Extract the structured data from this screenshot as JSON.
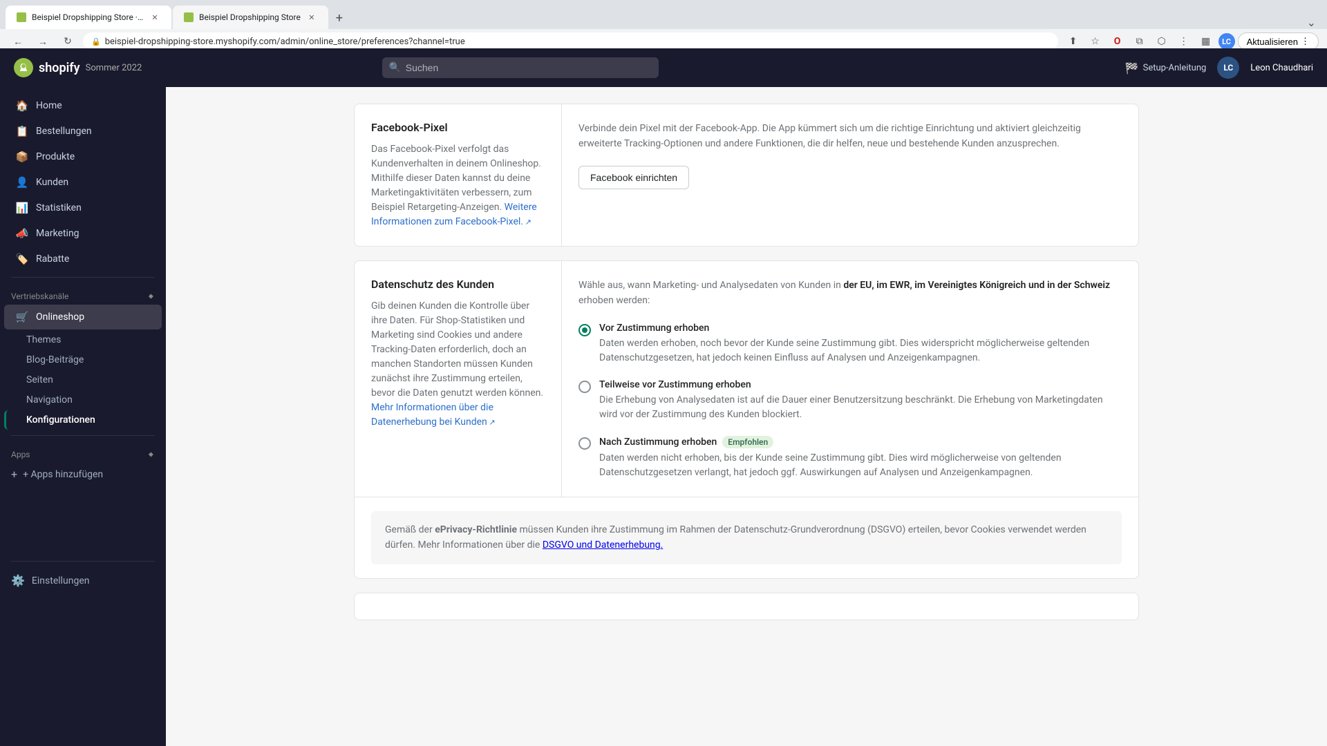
{
  "browser": {
    "tabs": [
      {
        "id": "tab1",
        "title": "Beispiel Dropshipping Store ·...",
        "active": true,
        "favicon_color": "#96bf48"
      },
      {
        "id": "tab2",
        "title": "Beispiel Dropshipping Store",
        "active": false,
        "favicon_color": "#96bf48"
      }
    ],
    "address": "beispiel-dropshipping-store.myshopify.com/admin/online_store/preferences?channel=true",
    "update_btn": "Aktualisieren"
  },
  "header": {
    "logo_text": "shopify",
    "season": "Sommer 2022",
    "search_placeholder": "Suchen",
    "setup_link": "Setup-Anleitung",
    "user_initials": "LC",
    "user_name": "Leon Chaudhari"
  },
  "sidebar": {
    "nav_items": [
      {
        "id": "home",
        "label": "Home",
        "icon": "🏠"
      },
      {
        "id": "bestellungen",
        "label": "Bestellungen",
        "icon": "📋"
      },
      {
        "id": "produkte",
        "label": "Produkte",
        "icon": "📦"
      },
      {
        "id": "kunden",
        "label": "Kunden",
        "icon": "👤"
      },
      {
        "id": "statistiken",
        "label": "Statistiken",
        "icon": "📊"
      },
      {
        "id": "marketing",
        "label": "Marketing",
        "icon": "📣"
      },
      {
        "id": "rabatte",
        "label": "Rabatte",
        "icon": "🏷️"
      }
    ],
    "vertriebskanaele_label": "Vertriebskanäle",
    "online_shop_label": "Onlineshop",
    "sub_items": [
      {
        "id": "themes",
        "label": "Themes"
      },
      {
        "id": "blog-beitraege",
        "label": "Blog-Beiträge"
      },
      {
        "id": "seiten",
        "label": "Seiten"
      },
      {
        "id": "navigation",
        "label": "Navigation"
      },
      {
        "id": "konfigurationen",
        "label": "Konfigurationen",
        "current": true
      }
    ],
    "apps_label": "Apps",
    "add_apps_label": "+ Apps hinzufügen",
    "settings_label": "Einstellungen"
  },
  "facebook_section": {
    "title": "Facebook-Pixel",
    "description": "Das Facebook-Pixel verfolgt das Kundenverhalten in deinem Onlineshop. Mithilfe dieser Daten kannst du deine Marketingaktivitäten verbessern, zum Beispiel Retargeting-Anzeigen.",
    "link_text": "Weitere Informationen zum Facebook-Pixel.",
    "right_text": "Verbinde dein Pixel mit der Facebook-App. Die App kümmert sich um die richtige Einrichtung und aktiviert gleichzeitig erweiterte Tracking-Optionen und andere Funktionen, die dir helfen, neue und bestehende Kunden anzusprechen.",
    "button_label": "Facebook einrichten"
  },
  "datenschutz_section": {
    "title": "Datenschutz des Kunden",
    "description": "Gib deinen Kunden die Kontrolle über ihre Daten. Für Shop-Statistiken und Marketing sind Cookies und andere Tracking-Daten erforderlich, doch an manchen Standorten müssen Kunden zunächst ihre Zustimmung erteilen, bevor die Daten genutzt werden können.",
    "link_text": "Mehr Informationen über die Datenerhebung bei Kunden",
    "right_intro": "Wähle aus, wann Marketing- und Analysedaten von Kunden in",
    "right_bold": "der EU, im EWR, im Vereinigtes Königreich und in der Schweiz",
    "right_end": "erhoben werden:",
    "radio_options": [
      {
        "id": "vor-zustimmung",
        "label": "Vor Zustimmung erhoben",
        "selected": true,
        "badge": null,
        "desc": "Daten werden erhoben, noch bevor der Kunde seine Zustimmung gibt. Dies widerspricht möglicherweise geltenden Datenschutzgesetzen, hat jedoch keinen Einfluss auf Analysen und Anzeigenkampagnen."
      },
      {
        "id": "teilweise-vor-zustimmung",
        "label": "Teilweise vor Zustimmung erhoben",
        "selected": false,
        "badge": null,
        "desc": "Die Erhebung von Analysedaten ist auf die Dauer einer Benutzersitzung beschränkt. Die Erhebung von Marketingdaten wird vor der Zustimmung des Kunden blockiert."
      },
      {
        "id": "nach-zustimmung",
        "label": "Nach Zustimmung erhoben",
        "selected": false,
        "badge": "Empfohlen",
        "desc": "Daten werden nicht erhoben, bis der Kunde seine Zustimmung gibt. Dies wird möglicherweise von geltenden Datenschutzgesetzen verlangt, hat jedoch ggf. Auswirkungen auf Analysen und Anzeigenkampagnen."
      }
    ],
    "info_text_1": "Gemäß der",
    "info_bold": "ePrivacy-Richtlinie",
    "info_text_2": "müssen Kunden ihre Zustimmung im Rahmen der Datenschutz-Grundverordnung (DSGVO) erteilen, bevor Cookies verwendet werden dürfen. Mehr Informationen über die",
    "info_link": "DSGVO und Datenerhebung.",
    "info_text_3": ""
  }
}
